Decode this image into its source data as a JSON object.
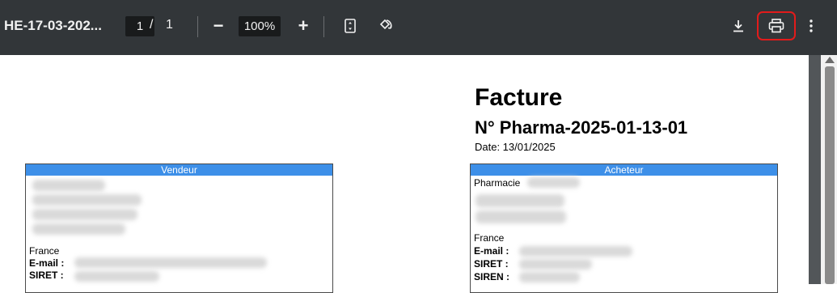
{
  "toolbar": {
    "title": "HE-17-03-202...",
    "page_current": "1",
    "page_separator": "/",
    "page_total": "1",
    "zoom_out": "−",
    "zoom_level": "100%",
    "zoom_in": "+"
  },
  "invoice": {
    "title": "Facture",
    "number": "N° Pharma-2025-01-13-01",
    "date": "Date: 13/01/2025",
    "seller": {
      "header": "Vendeur",
      "country": "France",
      "email_label": "E-mail :",
      "siret_label": "SIRET :"
    },
    "buyer": {
      "header": "Acheteur",
      "name_prefix": "Pharmacie",
      "country": "France",
      "email_label": "E-mail :",
      "siret_label": "SIRET :",
      "siren_label": "SIREN :"
    }
  }
}
